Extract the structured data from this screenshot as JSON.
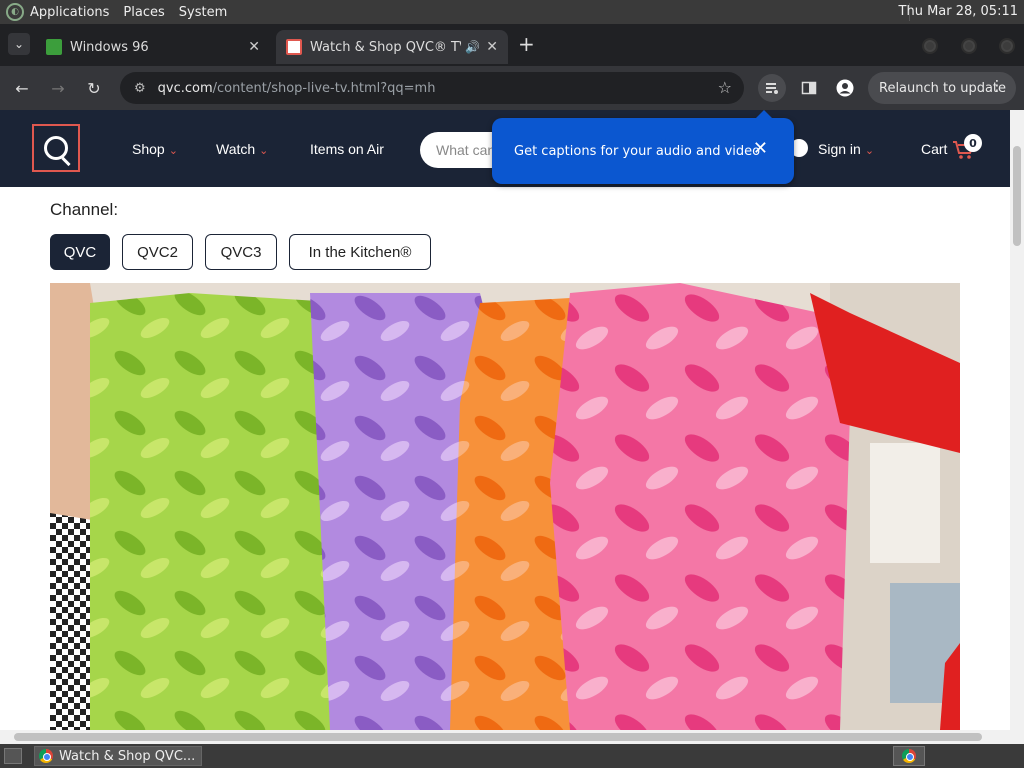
{
  "os": {
    "menu": [
      "Applications",
      "Places",
      "System"
    ],
    "clock": "Thu Mar 28, 05:11"
  },
  "tabs": [
    {
      "title": "Windows 96",
      "active": false
    },
    {
      "title": "Watch & Shop QVC® TV -",
      "active": true
    }
  ],
  "toolbar": {
    "url_host": "qvc.com",
    "url_path": "/content/shop-live-tv.html?qq=mh",
    "relaunch_label": "Relaunch to update"
  },
  "site": {
    "nav": {
      "shop": "Shop",
      "watch": "Watch",
      "items_on_air": "Items on Air",
      "search_placeholder": "What can",
      "sign_in": "Sign in",
      "cart": "Cart",
      "cart_count": "0"
    },
    "captions_popup": "Get captions for your audio and video",
    "channel_label": "Channel:",
    "channels": [
      "QVC",
      "QVC2",
      "QVC3",
      "In the Kitchen®"
    ],
    "active_channel": "QVC"
  },
  "taskbar": {
    "window_title": "Watch & Shop QVC..."
  }
}
